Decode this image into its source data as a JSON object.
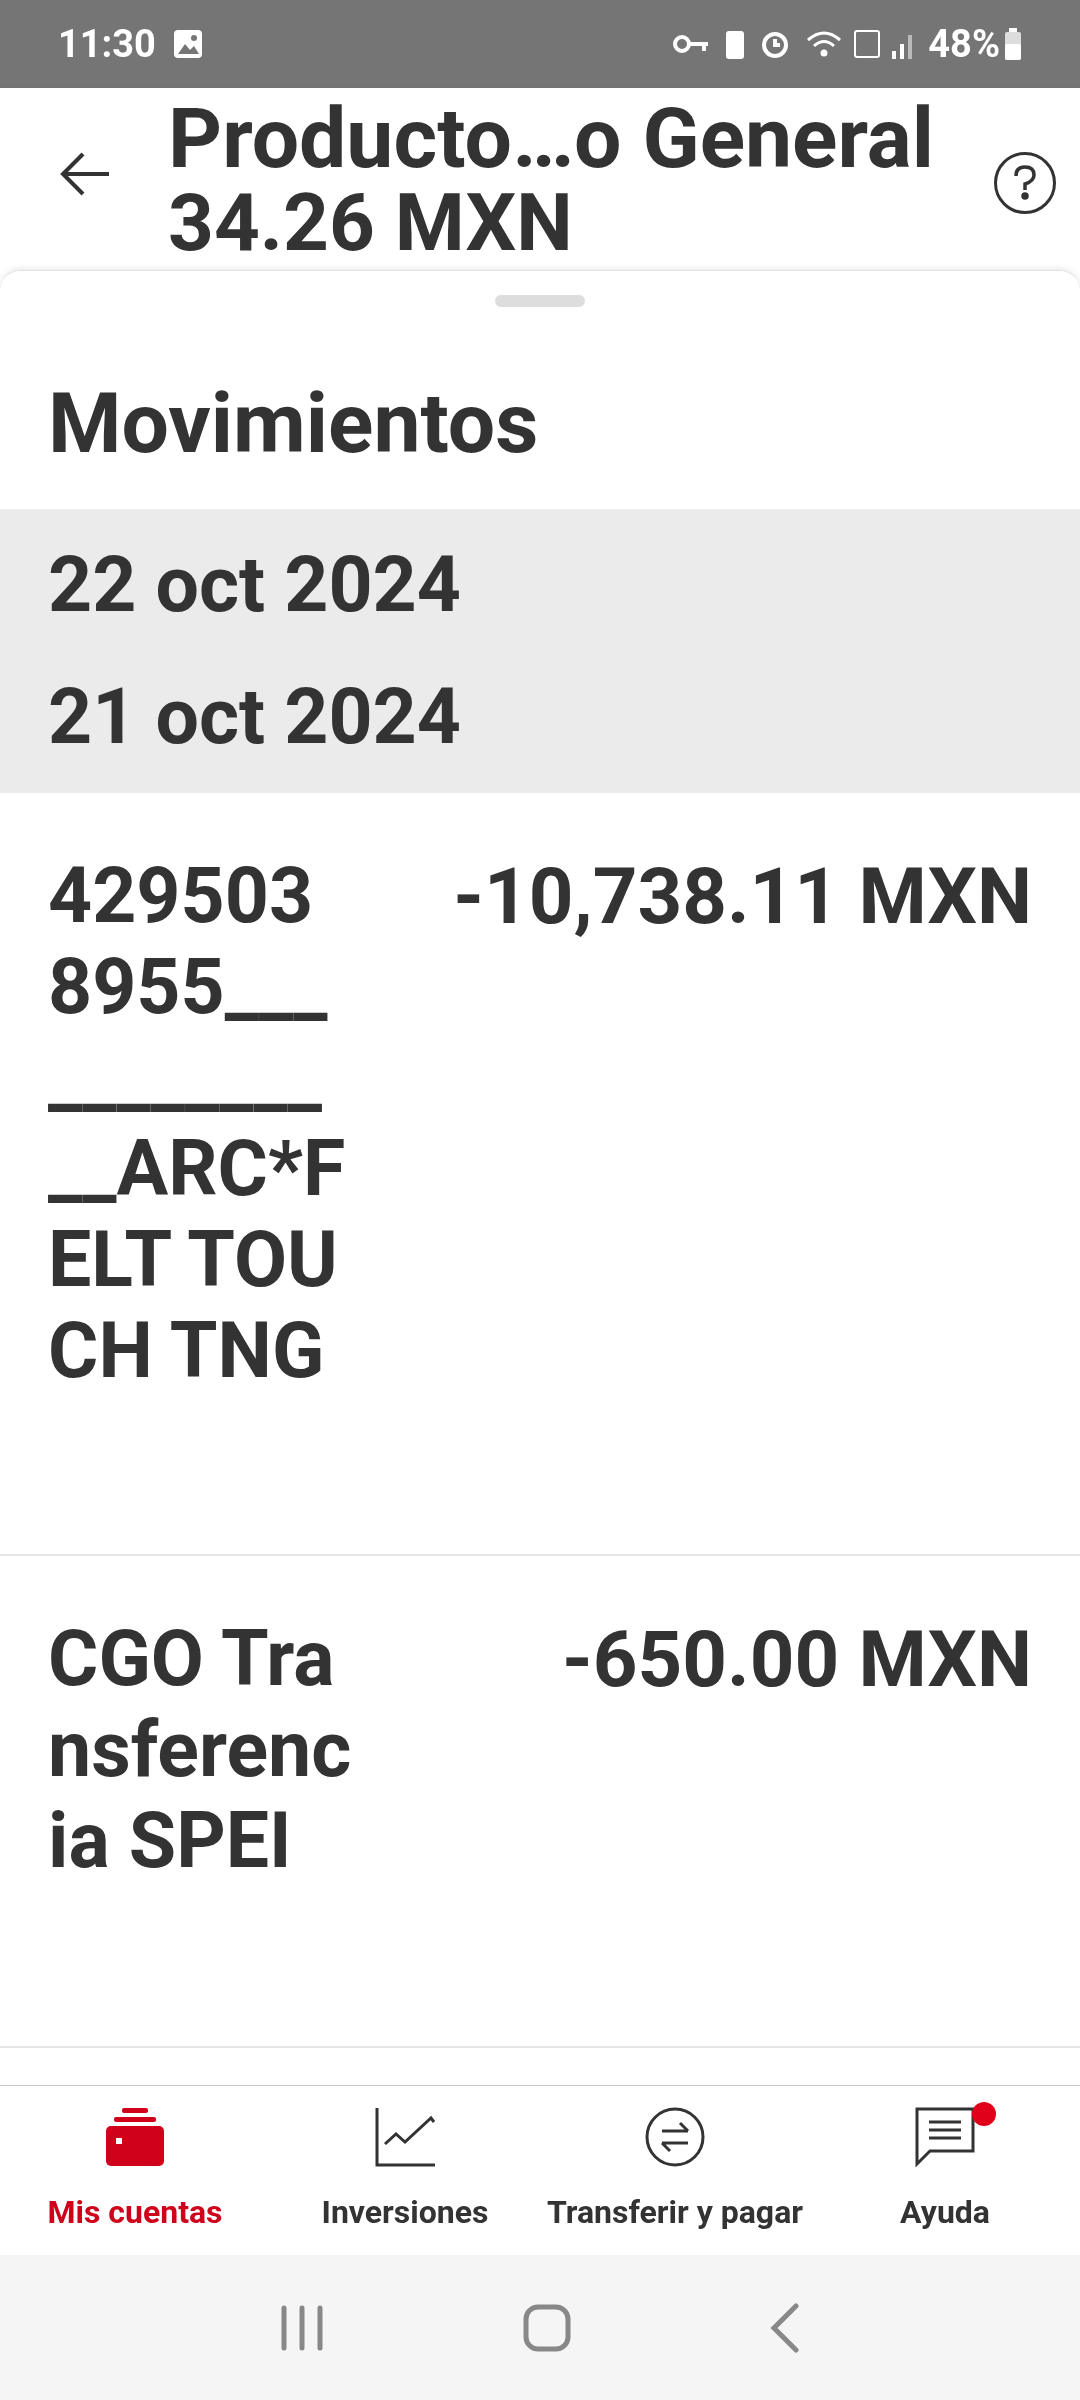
{
  "status_bar": {
    "time": "11:30",
    "battery": "48%"
  },
  "header": {
    "title": "Producto…o General",
    "subtitle": "34.26 MXN"
  },
  "section_title": "Movimientos",
  "date_groups": [
    {
      "label": "22 oct 2024"
    },
    {
      "label": "21 oct 2024"
    }
  ],
  "transactions": [
    {
      "description": "4295038955_____________ARC*FELT TOUCH TNG",
      "amount": "-10,738.11 MXN"
    },
    {
      "description": "CGO Transferencia SPEI",
      "amount": "-650.00 MXN"
    }
  ],
  "bottom_nav": [
    {
      "label": "Mis cuentas",
      "kind": "wallet",
      "selected": true,
      "badge": false
    },
    {
      "label": "Inversiones",
      "kind": "chart",
      "selected": false,
      "badge": false
    },
    {
      "label": "Transferir y pagar",
      "kind": "transfer",
      "selected": false,
      "badge": false
    },
    {
      "label": "Ayuda",
      "kind": "chat",
      "selected": false,
      "badge": true
    }
  ]
}
